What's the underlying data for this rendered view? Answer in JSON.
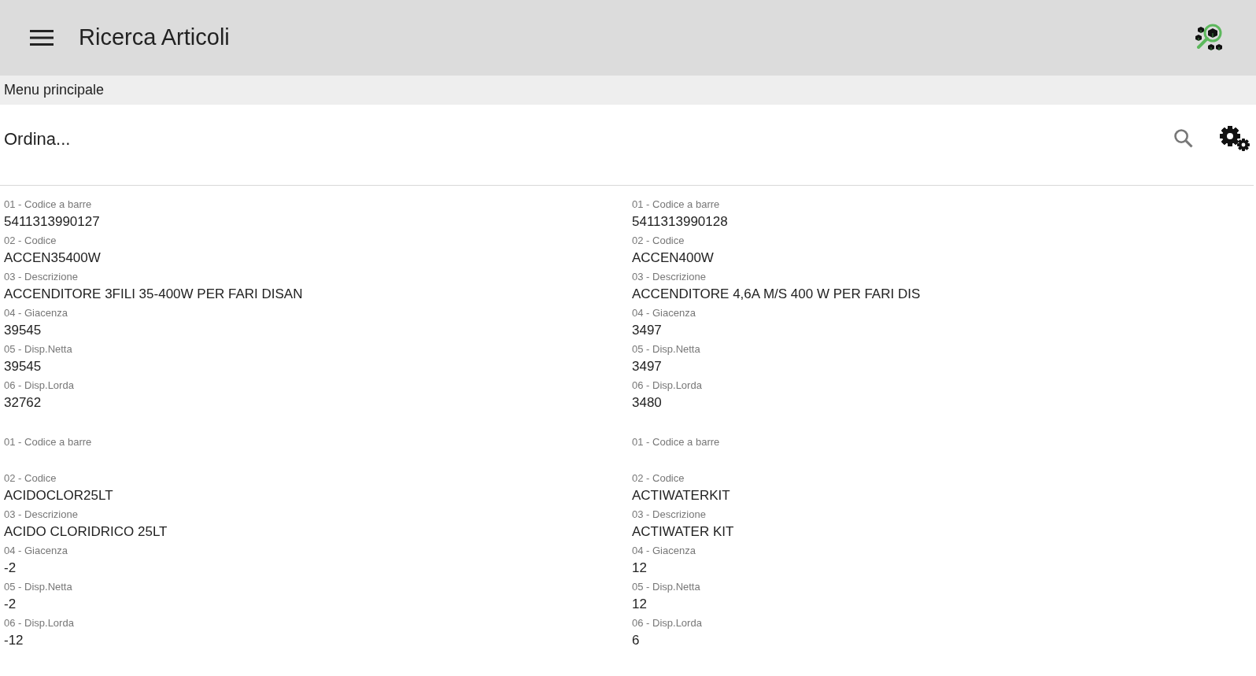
{
  "app_bar": {
    "title": "Ricerca Articoli"
  },
  "breadcrumb": "Menu principale",
  "sort_field": {
    "placeholder": "Ordina..."
  },
  "items": [
    {
      "fields": [
        {
          "label": "01 - Codice a barre",
          "value": "5411313990127"
        },
        {
          "label": "02 - Codice",
          "value": "ACCEN35400W"
        },
        {
          "label": "03 - Descrizione",
          "value": "ACCENDITORE 3FILI 35-400W PER FARI DISAN"
        },
        {
          "label": "04 - Giacenza",
          "value": "39545"
        },
        {
          "label": "05 - Disp.Netta",
          "value": "39545"
        },
        {
          "label": "06 - Disp.Lorda",
          "value": "32762"
        }
      ]
    },
    {
      "fields": [
        {
          "label": "01 - Codice a barre",
          "value": "5411313990128"
        },
        {
          "label": "02 - Codice",
          "value": "ACCEN400W"
        },
        {
          "label": "03 - Descrizione",
          "value": "ACCENDITORE 4,6A M/S 400 W PER FARI DIS"
        },
        {
          "label": "04 - Giacenza",
          "value": "3497"
        },
        {
          "label": "05 - Disp.Netta",
          "value": "3497"
        },
        {
          "label": "06 - Disp.Lorda",
          "value": "3480"
        }
      ]
    },
    {
      "fields": [
        {
          "label": "01 - Codice a barre"
        },
        {
          "label": "02 - Codice",
          "value": "ACIDOCLOR25LT"
        },
        {
          "label": "03 - Descrizione",
          "value": "ACIDO CLORIDRICO 25LT"
        },
        {
          "label": "04 - Giacenza",
          "value": "-2"
        },
        {
          "label": "05 - Disp.Netta",
          "value": "-2"
        },
        {
          "label": "06 - Disp.Lorda",
          "value": "-12"
        }
      ]
    },
    {
      "fields": [
        {
          "label": "01 - Codice a barre"
        },
        {
          "label": "02 - Codice",
          "value": "ACTIWATERKIT"
        },
        {
          "label": "03 - Descrizione",
          "value": "ACTIWATER KIT"
        },
        {
          "label": "04 - Giacenza",
          "value": "12"
        },
        {
          "label": "05 - Disp.Netta",
          "value": "12"
        },
        {
          "label": "06 - Disp.Lorda",
          "value": "6"
        }
      ]
    }
  ]
}
